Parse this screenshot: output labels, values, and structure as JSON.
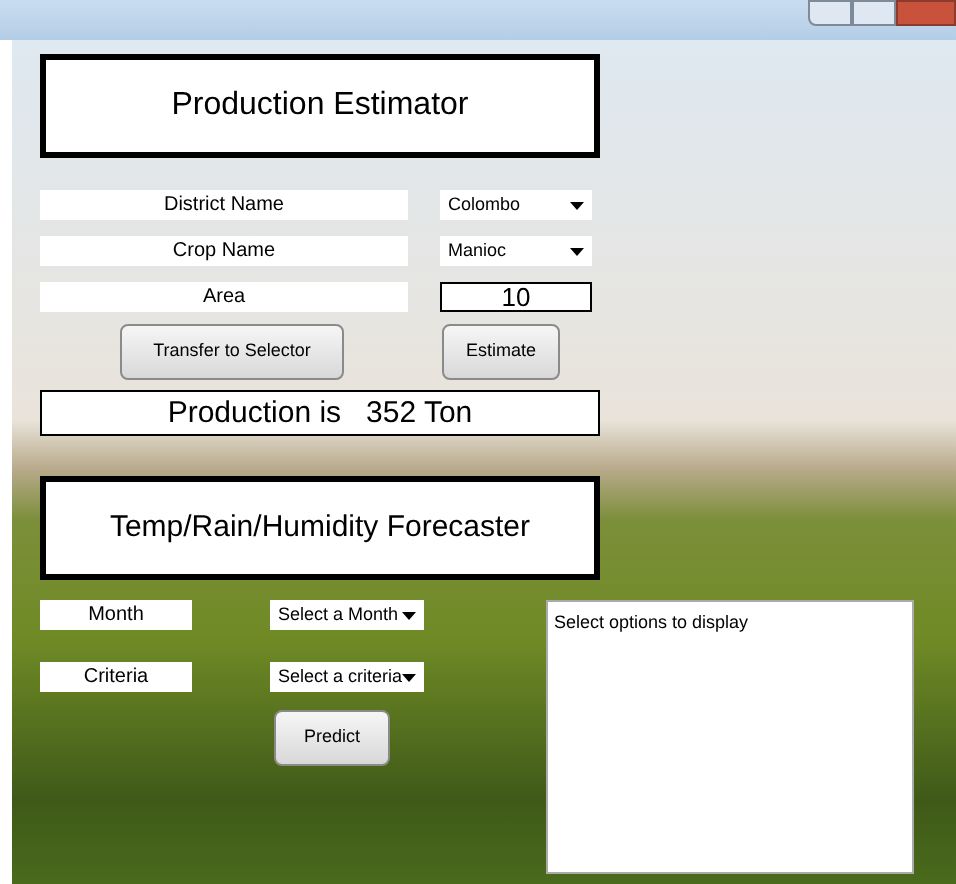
{
  "estimator": {
    "title": "Production Estimator",
    "fields": [
      {
        "label": "District Name",
        "kind": "dropdown",
        "value": "Colombo"
      },
      {
        "label": "Crop Name",
        "kind": "dropdown",
        "value": "Manioc"
      },
      {
        "label": "Area",
        "kind": "input",
        "value": "10"
      }
    ],
    "buttons": [
      "Transfer to Selector",
      "Estimate"
    ],
    "result": "Production is   352 Ton"
  },
  "forecaster": {
    "title": "Temp/Rain/Humidity Forecaster",
    "fields": [
      {
        "label": "Month",
        "placeholder": "Select a Month"
      },
      {
        "label": "Criteria",
        "placeholder": "Select a criteria"
      }
    ],
    "button": "Predict",
    "output": "Select options to display"
  }
}
